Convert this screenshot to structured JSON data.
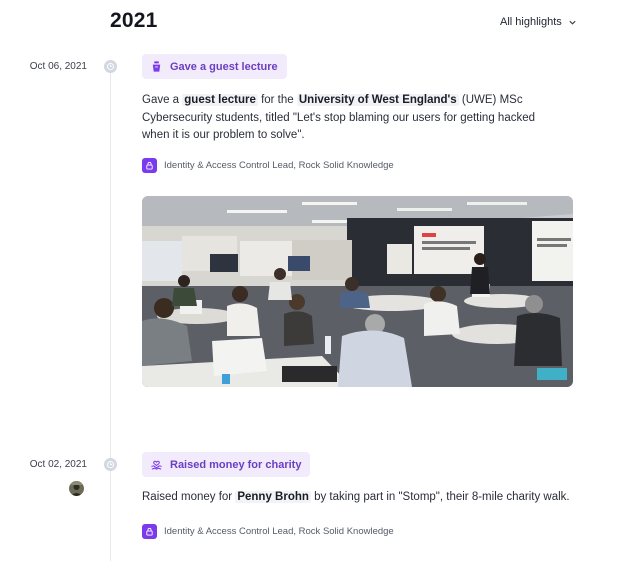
{
  "year": "2021",
  "filter": {
    "label": "All highlights",
    "icon": "chevron-down-icon"
  },
  "entries": [
    {
      "date": "Oct 06, 2021",
      "badge": {
        "label": "Gave a guest lecture",
        "icon": "podium-icon"
      },
      "text": {
        "p1": "Gave a",
        "h1": "guest lecture",
        "p2": "for the",
        "h2": "University of West England's",
        "p3": "(UWE) MSc Cybersecurity students, titled \"Let's stop blaming our users for getting hacked when it is our problem to solve\"."
      },
      "role": {
        "label": "Identity & Access Control Lead, Rock Solid Knowledge",
        "icon": "lock-icon"
      },
      "photo": {
        "slide_left": "\"Let's stop blaming our users for getting hacked when it is our problem to solve\"",
        "slide_right": "\"Let's stop blami... when i...\""
      }
    },
    {
      "date": "Oct 02, 2021",
      "badge": {
        "label": "Raised money for charity",
        "icon": "charity-hands-icon"
      },
      "text": {
        "p1": "Raised money for",
        "h1": "Penny Brohn",
        "p2": "by taking part in \"Stomp\", their 8-mile charity walk."
      },
      "role": {
        "label": "Identity & Access Control Lead, Rock Solid Knowledge",
        "icon": "lock-icon"
      }
    }
  ],
  "colors": {
    "accent": "#7c3aed",
    "badge_bg": "#f1ebfb",
    "badge_text": "#6b3fc2",
    "timeline": "#e6e8ee"
  }
}
